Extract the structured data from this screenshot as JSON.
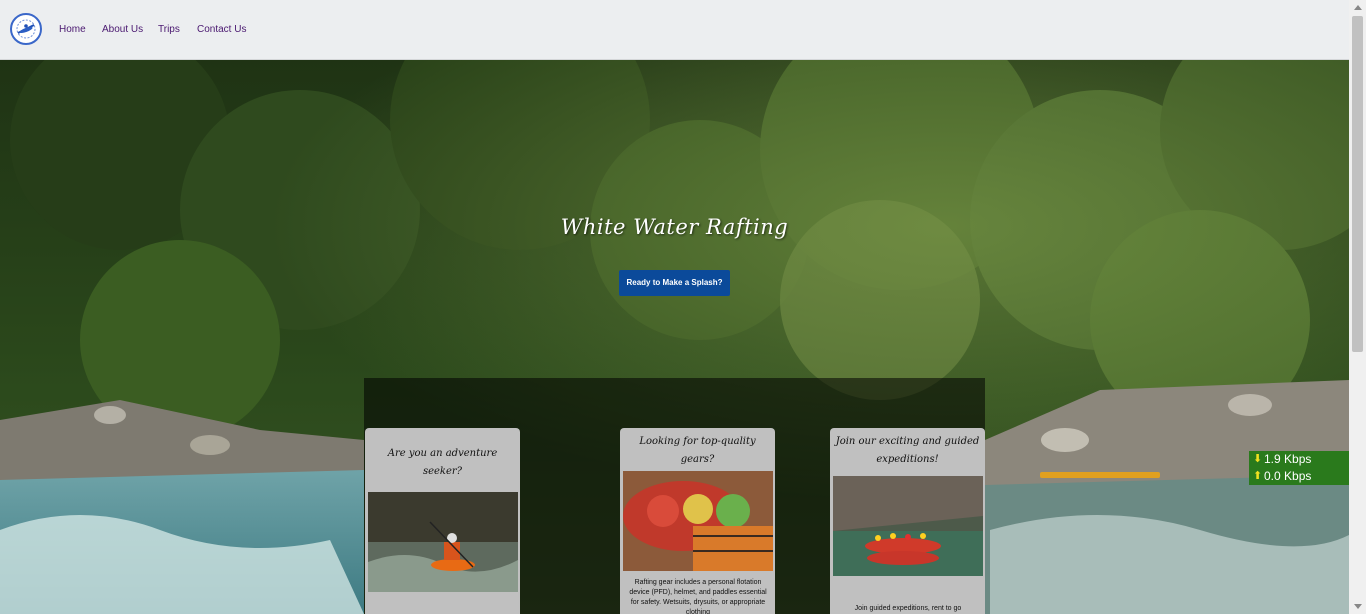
{
  "nav": {
    "links": [
      "Home",
      "About Us",
      "Trips",
      "Contact Us"
    ],
    "color": "#4a1870"
  },
  "hero": {
    "title": "White Water Rafting",
    "cta_label": "Ready to Make a Splash?"
  },
  "cards": [
    {
      "title": "Are you an adventure seeker?",
      "image": "kayaker-image",
      "text": ""
    },
    {
      "title": "Looking for top-quality gears?",
      "image": "rafting-gear-image",
      "text": "Rafting gear includes a personal flotation device (PFD), helmet, and paddles essential for safety. Wetsuits, drysuits, or appropriate clothing"
    },
    {
      "title": "Join our exciting and guided expeditions!",
      "image": "raft-group-image",
      "text": "Join guided expeditions, rent to go"
    }
  ],
  "speed_widget": {
    "download": "1.9 Kbps",
    "upload": "0.0 Kbps"
  },
  "colors": {
    "cta_bg": "#0b4a9a",
    "navbar_bg": "#eceef0",
    "widget_bg": "#2a7a1c"
  }
}
